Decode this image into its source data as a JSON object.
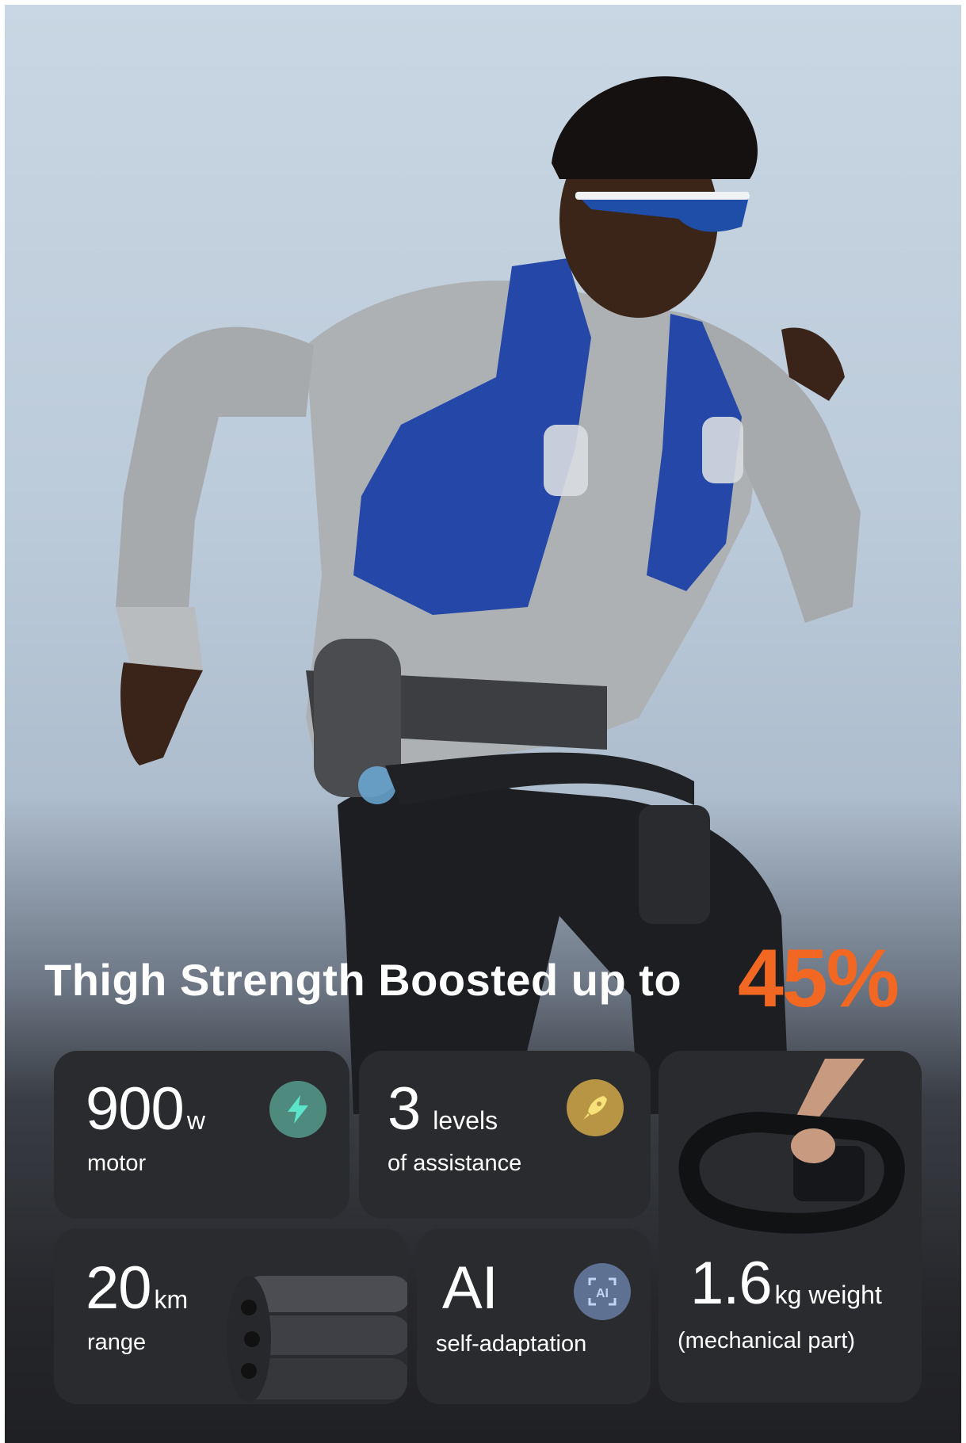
{
  "headline": {
    "lead": "Thigh Strength Boosted up to",
    "value": "45%"
  },
  "specs": [
    {
      "value": "900",
      "unit": "w",
      "label": "motor",
      "icon": "lightning-icon",
      "icon_color": "#4e8a7d"
    },
    {
      "value": "3",
      "unit": "levels",
      "label": "of assistance",
      "icon": "rocket-icon",
      "icon_color": "#b79545"
    },
    {
      "value": "20",
      "unit": "km",
      "label": "range",
      "icon": "battery-pack-image"
    },
    {
      "value": "AI",
      "unit": "",
      "label": "self-adaptation",
      "icon": "ai-scan-icon",
      "icon_color": "#5f7192"
    },
    {
      "value": "1.6",
      "unit": "kg weight",
      "label": "(mechanical part)",
      "icon": "exoskeleton-device-image"
    }
  ],
  "colors": {
    "accent": "#f26722",
    "card": "#2a2b2f"
  }
}
